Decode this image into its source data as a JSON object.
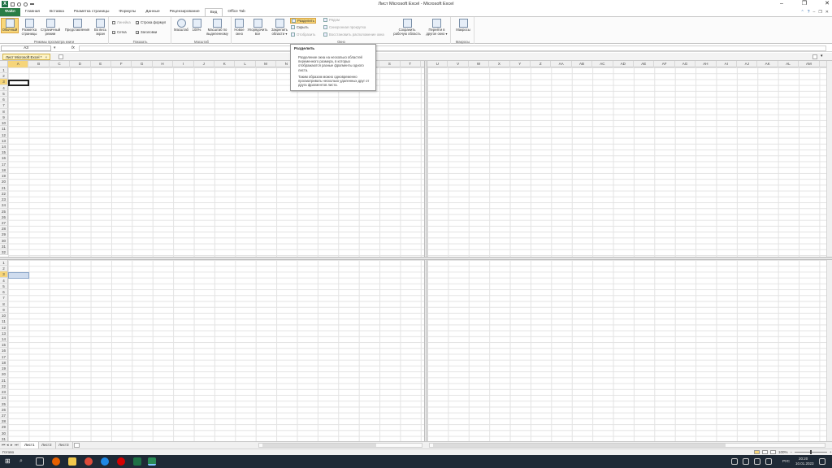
{
  "window": {
    "title": "Лист Microsoft Excel - Microsoft Excel",
    "logo": "X"
  },
  "ribbon_tabs": [
    "Файл",
    "Главная",
    "Вставка",
    "Разметка страницы",
    "Формулы",
    "Данные",
    "Рецензирование",
    "Вид",
    "Office Tab"
  ],
  "active_tab_index": 7,
  "groups": {
    "book_views": {
      "label": "Режимы просмотра книги",
      "normal": "Обычный",
      "page_layout": "Разметка страницы",
      "page_break": "Страничный режим",
      "custom_views": "Представления",
      "full_screen": "Во весь экран"
    },
    "show": {
      "label": "Показать",
      "ruler": "Линейка",
      "formula_bar": "Строка формул",
      "gridlines": "Сетка",
      "headings": "Заголовки"
    },
    "zoom": {
      "label": "Масштаб",
      "zoom": "Масштаб",
      "zoom100": "100%",
      "zoom_selection": "Масштаб по выделенному"
    },
    "window": {
      "label": "Окно",
      "new_window": "Новое окно",
      "arrange_all": "Упорядочить все",
      "freeze": "Закрепить области",
      "split": "Разделить",
      "hide": "Скрыть",
      "unhide": "Отобразить",
      "side_by_side": "Рядом",
      "sync_scroll": "Синхронная прокрутка",
      "reset_position": "Восстановить расположение окна",
      "save_workspace": "Сохранить рабочую область",
      "switch_windows": "Перейти в другое окно"
    },
    "macros": {
      "label": "Макросы",
      "macros": "Макросы"
    }
  },
  "formula_bar": {
    "name_box": "A3",
    "fx": "fx",
    "value": ""
  },
  "doc_tab": {
    "label": "Лист Microsoft Excel *",
    "close": "×"
  },
  "tooltip": {
    "title": "Разделить",
    "p1": "Разделение окна на несколько областей переменного размера, в которых отображаются разные фрагменты одного листа.",
    "p2": "Таким образом можно одновременно просматривать несколько удаленных друг от друга фрагментов листа."
  },
  "columns_left": [
    "A",
    "B",
    "C",
    "D",
    "E",
    "F",
    "G",
    "H",
    "I",
    "J",
    "K",
    "L",
    "M",
    "N",
    "O",
    "P",
    "Q",
    "R",
    "S",
    "T"
  ],
  "columns_right": [
    "U",
    "V",
    "W",
    "X",
    "Y",
    "Z",
    "AA",
    "AB",
    "AC",
    "AD",
    "AE",
    "AF",
    "AG",
    "AH",
    "AI",
    "AJ",
    "AK",
    "AL",
    "AM"
  ],
  "active_cell": "A3",
  "sheets": [
    "Лист1",
    "Лист2",
    "Лист3"
  ],
  "active_sheet_index": 0,
  "status": {
    "ready": "Готово",
    "zoom": "100%"
  },
  "taskbar": {
    "lang": "РУС",
    "time": "20:20",
    "date": "10.01.2023"
  },
  "colors": {
    "file_tab": "#2a7d46",
    "highlight": "#f8d77a",
    "taskbar": "#1f2a36"
  }
}
